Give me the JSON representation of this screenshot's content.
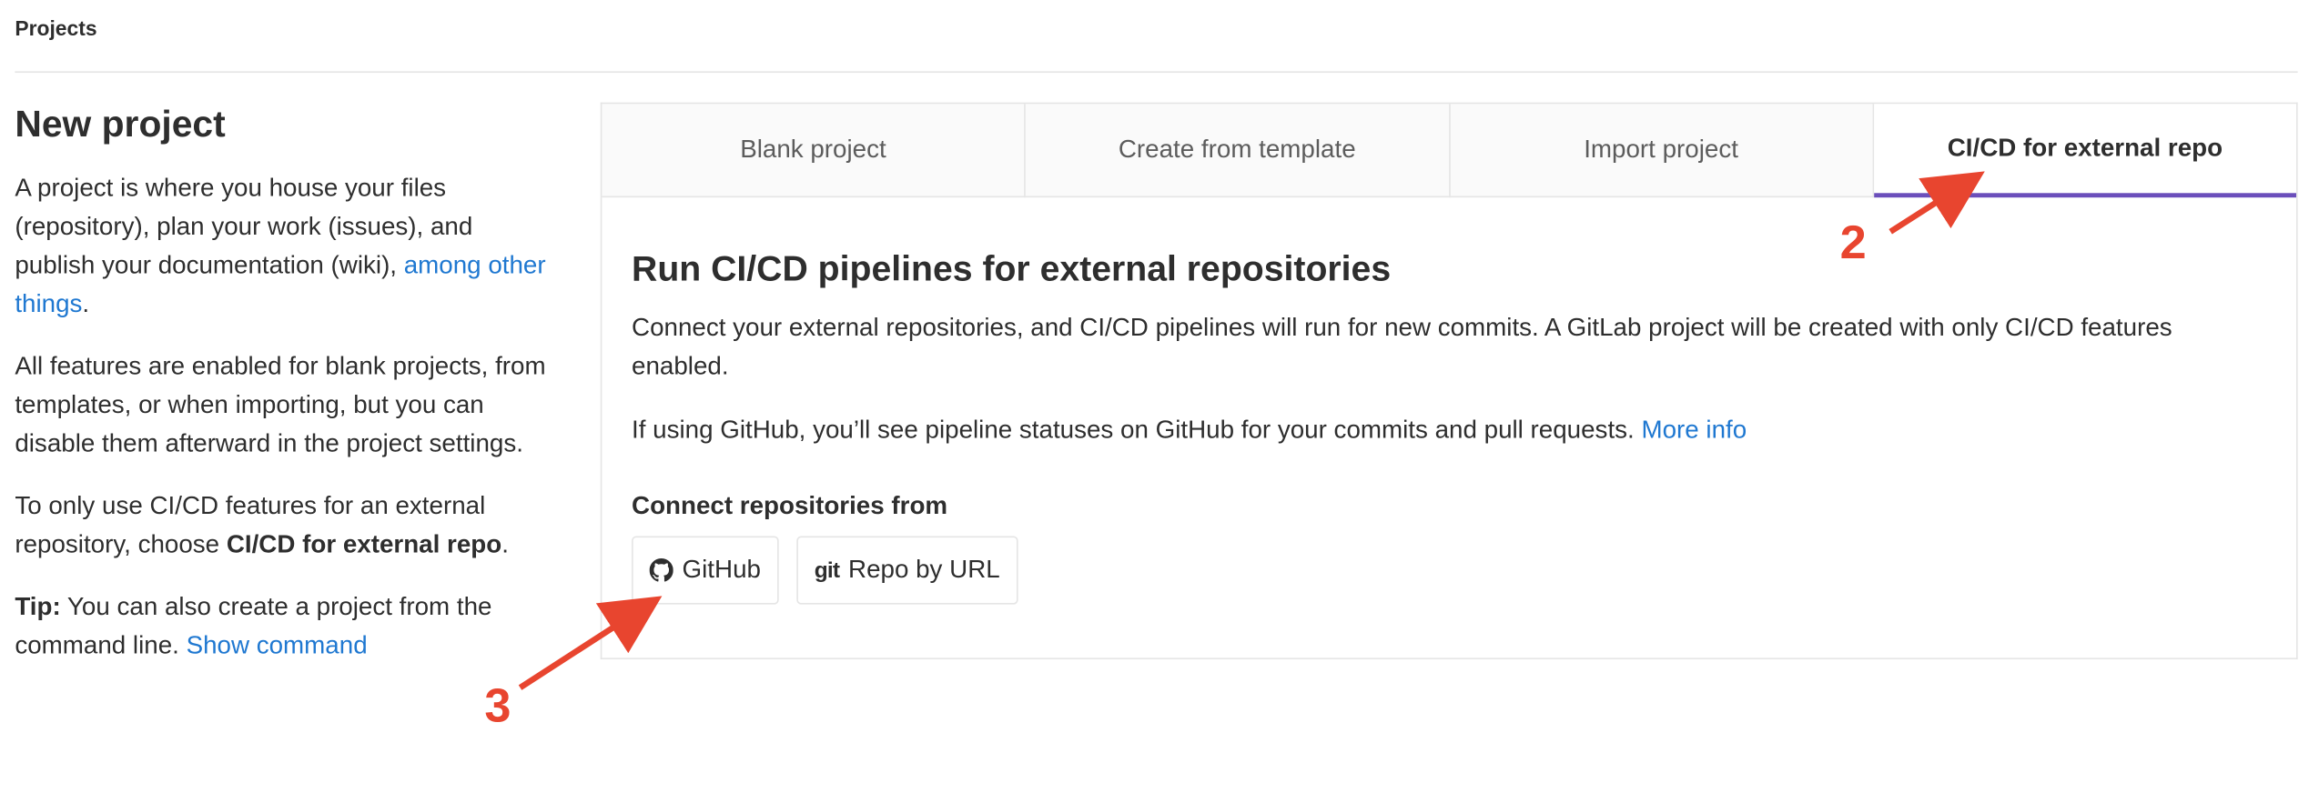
{
  "breadcrumb": "Projects",
  "left": {
    "title": "New project",
    "p1_text": "A project is where you house your files (repository), plan your work (issues), and publish your documentation (wiki), ",
    "p1_link": "among other things",
    "p1_end": ".",
    "p2": "All features are enabled for blank projects, from templates, or when importing, but you can disable them afterward in the project settings.",
    "p3_text": "To only use CI/CD features for an external repository, choose ",
    "p3_bold": "CI/CD for external repo",
    "p3_end": ".",
    "tip_label": "Tip:",
    "tip_text": " You can also create a project from the command line. ",
    "tip_link": "Show command"
  },
  "tabs": [
    {
      "label": "Blank project"
    },
    {
      "label": "Create from template"
    },
    {
      "label": "Import project"
    },
    {
      "label": "CI/CD for external repo",
      "active": true
    }
  ],
  "panel": {
    "title": "Run CI/CD pipelines for external repositories",
    "desc": "Connect your external repositories, and CI/CD pipelines will run for new commits. A GitLab project will be created with only CI/CD features enabled.",
    "github_text": "If using GitHub, you’ll see pipeline statuses on GitHub for your commits and pull requests. ",
    "more_info": "More info",
    "connect_label": "Connect repositories from",
    "buttons": {
      "github": "GitHub",
      "git_glyph": "git",
      "repo_url": "Repo by URL"
    }
  },
  "annotations": {
    "step2": "2",
    "step3": "3",
    "color": "#e8452f"
  },
  "colors": {
    "link": "#1f78d1",
    "active_tab_border": "#6b4fbb"
  },
  "icons": [
    "github-icon",
    "git-icon",
    "arrow-annotation-icon"
  ]
}
